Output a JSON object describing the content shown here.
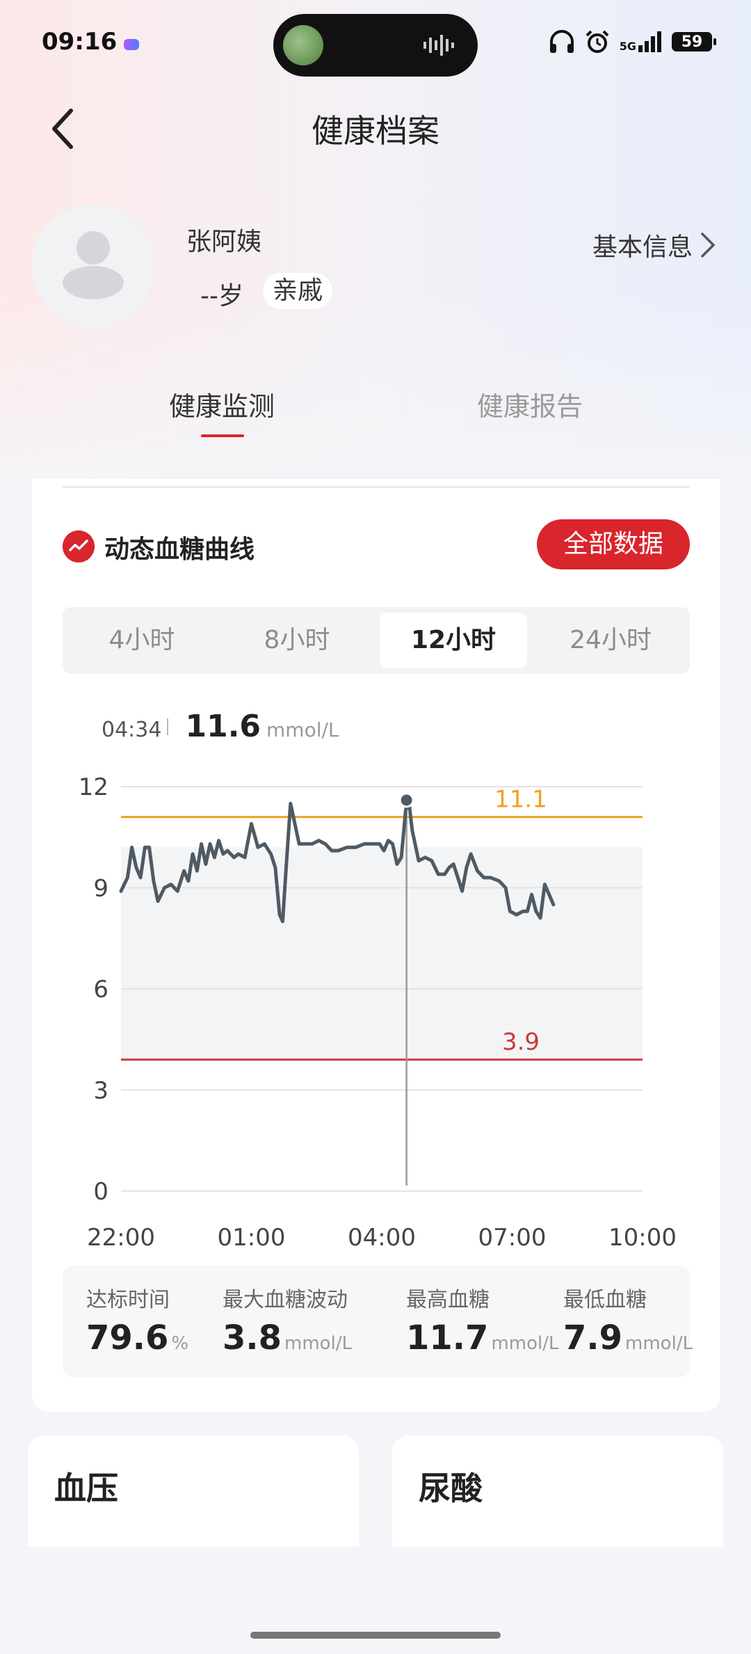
{
  "status_bar": {
    "time": "09:16",
    "network": "5G",
    "battery": "59"
  },
  "header": {
    "title": "健康档案",
    "back_icon": "chevron-left-icon"
  },
  "profile": {
    "name": "张阿姨",
    "age": "--岁",
    "relation": "亲戚",
    "basic_info_label": "基本信息"
  },
  "tabs": [
    {
      "label": "健康监测",
      "active": true
    },
    {
      "label": "健康报告",
      "active": false
    }
  ],
  "glucose": {
    "section_title": "动态血糖曲线",
    "all_data_button": "全部数据",
    "ranges": [
      {
        "label": "4小时",
        "active": false
      },
      {
        "label": "8小时",
        "active": false
      },
      {
        "label": "12小时",
        "active": true
      },
      {
        "label": "24小时",
        "active": false
      }
    ],
    "readout": {
      "time": "04:34",
      "value": "11.6",
      "unit": "mmol/L"
    },
    "stats": [
      {
        "label": "达标时间",
        "value": "79.6",
        "unit": "%"
      },
      {
        "label": "最大血糖波动",
        "value": "3.8",
        "unit": "mmol/L"
      },
      {
        "label": "最高血糖",
        "value": "11.7",
        "unit": "mmol/L"
      },
      {
        "label": "最低血糖",
        "value": "7.9",
        "unit": "mmol/L"
      }
    ]
  },
  "chart_data": {
    "type": "line",
    "x_tick_labels": [
      "22:00",
      "01:00",
      "04:00",
      "07:00",
      "10:00"
    ],
    "y_tick_labels": [
      "0",
      "3",
      "6",
      "9",
      "12"
    ],
    "ylim": [
      0,
      12
    ],
    "x_range_hours": [
      0,
      12
    ],
    "thresholds": [
      {
        "value": 11.1,
        "label": "11.1",
        "color": "#f0a020"
      },
      {
        "value": 3.9,
        "label": "3.9",
        "color": "#c93a3a"
      }
    ],
    "target_band": [
      3.9,
      10.2
    ],
    "selected_point": {
      "x": 6.57,
      "y": 11.6
    },
    "series": [
      {
        "color": "#4f5a64",
        "points": [
          [
            0.0,
            8.9
          ],
          [
            0.15,
            9.3
          ],
          [
            0.25,
            10.2
          ],
          [
            0.35,
            9.6
          ],
          [
            0.45,
            9.3
          ],
          [
            0.55,
            10.2
          ],
          [
            0.65,
            10.2
          ],
          [
            0.75,
            9.2
          ],
          [
            0.85,
            8.6
          ],
          [
            1.0,
            9.0
          ],
          [
            1.15,
            9.1
          ],
          [
            1.3,
            8.9
          ],
          [
            1.45,
            9.5
          ],
          [
            1.55,
            9.2
          ],
          [
            1.65,
            10.0
          ],
          [
            1.75,
            9.5
          ],
          [
            1.85,
            10.3
          ],
          [
            1.95,
            9.7
          ],
          [
            2.05,
            10.3
          ],
          [
            2.15,
            9.9
          ],
          [
            2.25,
            10.4
          ],
          [
            2.35,
            10.0
          ],
          [
            2.45,
            10.1
          ],
          [
            2.6,
            9.9
          ],
          [
            2.7,
            10.0
          ],
          [
            2.85,
            9.9
          ],
          [
            3.0,
            10.9
          ],
          [
            3.15,
            10.2
          ],
          [
            3.3,
            10.3
          ],
          [
            3.45,
            10.0
          ],
          [
            3.55,
            9.6
          ],
          [
            3.65,
            8.2
          ],
          [
            3.72,
            8.0
          ],
          [
            3.8,
            9.6
          ],
          [
            3.9,
            11.5
          ],
          [
            4.0,
            10.9
          ],
          [
            4.1,
            10.3
          ],
          [
            4.25,
            10.3
          ],
          [
            4.4,
            10.3
          ],
          [
            4.55,
            10.4
          ],
          [
            4.7,
            10.3
          ],
          [
            4.85,
            10.1
          ],
          [
            5.0,
            10.1
          ],
          [
            5.2,
            10.2
          ],
          [
            5.4,
            10.2
          ],
          [
            5.6,
            10.3
          ],
          [
            5.8,
            10.3
          ],
          [
            5.95,
            10.3
          ],
          [
            6.05,
            10.1
          ],
          [
            6.15,
            10.4
          ],
          [
            6.25,
            10.3
          ],
          [
            6.35,
            9.7
          ],
          [
            6.45,
            9.9
          ],
          [
            6.55,
            11.3
          ],
          [
            6.62,
            11.6
          ],
          [
            6.7,
            10.7
          ],
          [
            6.85,
            9.8
          ],
          [
            7.0,
            9.9
          ],
          [
            7.15,
            9.8
          ],
          [
            7.3,
            9.4
          ],
          [
            7.45,
            9.4
          ],
          [
            7.55,
            9.6
          ],
          [
            7.65,
            9.7
          ],
          [
            7.75,
            9.3
          ],
          [
            7.85,
            8.9
          ],
          [
            7.95,
            9.6
          ],
          [
            8.05,
            10.0
          ],
          [
            8.2,
            9.5
          ],
          [
            8.35,
            9.3
          ],
          [
            8.5,
            9.3
          ],
          [
            8.7,
            9.2
          ],
          [
            8.85,
            9.0
          ],
          [
            8.95,
            8.3
          ],
          [
            9.1,
            8.2
          ],
          [
            9.25,
            8.3
          ],
          [
            9.35,
            8.3
          ],
          [
            9.45,
            8.8
          ],
          [
            9.55,
            8.3
          ],
          [
            9.65,
            8.1
          ],
          [
            9.75,
            9.1
          ],
          [
            9.85,
            8.8
          ],
          [
            9.95,
            8.5
          ]
        ]
      }
    ]
  },
  "cards": [
    {
      "title": "血压"
    },
    {
      "title": "尿酸"
    }
  ]
}
